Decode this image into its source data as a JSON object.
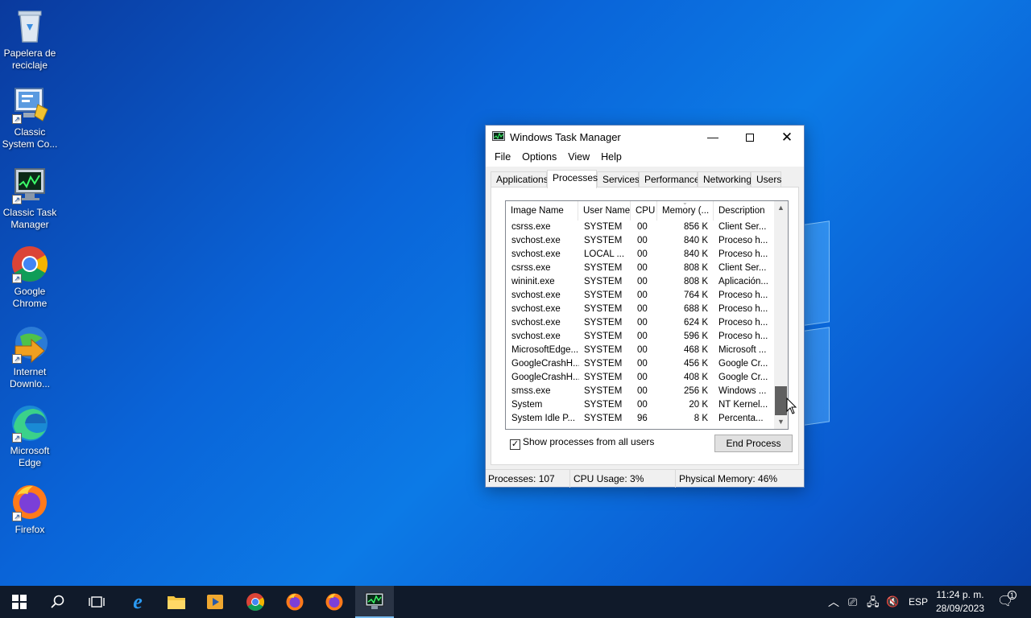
{
  "desktop": {
    "icons": [
      {
        "label_line1": "Papelera de",
        "label_line2": "reciclaje",
        "icon": "recycle-bin-icon"
      },
      {
        "label_line1": "Classic",
        "label_line2": "System Co...",
        "icon": "control-panel-icon"
      },
      {
        "label_line1": "Classic Task",
        "label_line2": "Manager",
        "icon": "task-manager-icon"
      },
      {
        "label_line1": "Google",
        "label_line2": "Chrome",
        "icon": "chrome-icon"
      },
      {
        "label_line1": "Internet",
        "label_line2": "Downlo...",
        "icon": "internet-download-manager-icon"
      },
      {
        "label_line1": "Microsoft",
        "label_line2": "Edge",
        "icon": "edge-icon"
      },
      {
        "label_line1": "Firefox",
        "label_line2": "",
        "icon": "firefox-icon"
      }
    ]
  },
  "window": {
    "title": "Windows Task Manager",
    "menu": [
      "File",
      "Options",
      "View",
      "Help"
    ],
    "tabs": [
      "Applications",
      "Processes",
      "Services",
      "Performance",
      "Networking",
      "Users"
    ],
    "active_tab": "Processes",
    "columns": [
      "Image Name",
      "User Name",
      "CPU",
      "Memory (...",
      "Description"
    ],
    "rows": [
      [
        "csrss.exe",
        "SYSTEM",
        "00",
        "856 K",
        "Client Ser..."
      ],
      [
        "svchost.exe",
        "SYSTEM",
        "00",
        "840 K",
        "Proceso h..."
      ],
      [
        "svchost.exe",
        "LOCAL ...",
        "00",
        "840 K",
        "Proceso h..."
      ],
      [
        "csrss.exe",
        "SYSTEM",
        "00",
        "808 K",
        "Client Ser..."
      ],
      [
        "wininit.exe",
        "SYSTEM",
        "00",
        "808 K",
        "Aplicación..."
      ],
      [
        "svchost.exe",
        "SYSTEM",
        "00",
        "764 K",
        "Proceso h..."
      ],
      [
        "svchost.exe",
        "SYSTEM",
        "00",
        "688 K",
        "Proceso h..."
      ],
      [
        "svchost.exe",
        "SYSTEM",
        "00",
        "624 K",
        "Proceso h..."
      ],
      [
        "svchost.exe",
        "SYSTEM",
        "00",
        "596 K",
        "Proceso h..."
      ],
      [
        "MicrosoftEdge...",
        "SYSTEM",
        "00",
        "468 K",
        "Microsoft ..."
      ],
      [
        "GoogleCrashH...",
        "SYSTEM",
        "00",
        "456 K",
        "Google Cr..."
      ],
      [
        "GoogleCrashH...",
        "SYSTEM",
        "00",
        "408 K",
        "Google Cr..."
      ],
      [
        "smss.exe",
        "SYSTEM",
        "00",
        "256 K",
        "Windows ..."
      ],
      [
        "System",
        "SYSTEM",
        "00",
        "20 K",
        "NT Kernel..."
      ],
      [
        "System Idle P...",
        "SYSTEM",
        "96",
        "8 K",
        "Percenta..."
      ]
    ],
    "show_all_label": "Show processes from all users",
    "show_all_checked": true,
    "end_process_label": "End Process",
    "status": {
      "processes": "Processes: 107",
      "cpu": "CPU Usage: 3%",
      "memory": "Physical Memory: 46%"
    }
  },
  "taskbar": {
    "language": "ESP",
    "time": "11:24 p. m.",
    "date": "28/09/2023",
    "notification_count": "1"
  },
  "colors": {
    "taskbar_bg": "#101a2a",
    "accent": "#76b9ed"
  }
}
